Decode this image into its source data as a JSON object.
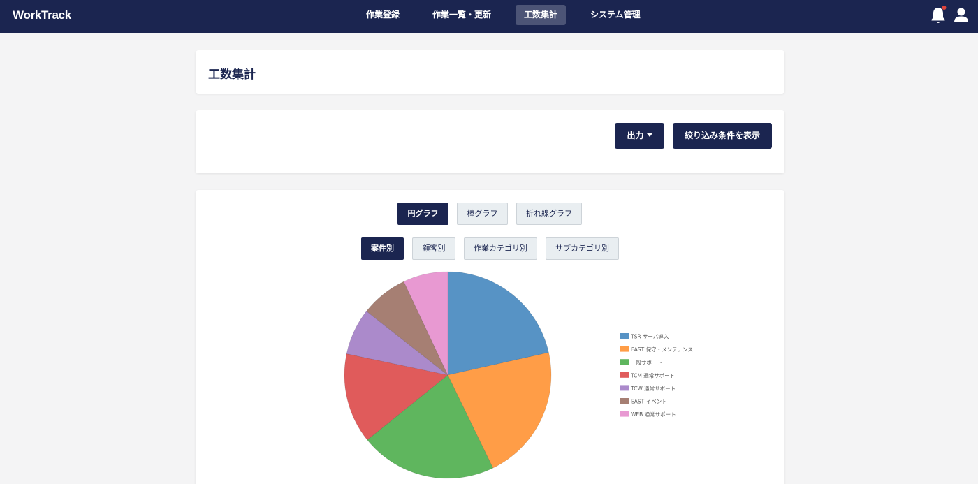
{
  "header": {
    "logo": "WorkTrack",
    "nav": [
      {
        "label": "作業登録",
        "active": false
      },
      {
        "label": "作業一覧・更新",
        "active": false
      },
      {
        "label": "工数集計",
        "active": true
      },
      {
        "label": "システム管理",
        "active": false
      }
    ],
    "notification_badge_color": "#e0443b",
    "icons": [
      "bell-icon",
      "user-icon"
    ]
  },
  "page": {
    "title": "工数集計"
  },
  "toolbar": {
    "export_label": "出力",
    "filter_label": "絞り込み条件を表示"
  },
  "graph_types": [
    {
      "label": "円グラフ",
      "active": true
    },
    {
      "label": "棒グラフ",
      "active": false
    },
    {
      "label": "折れ線グラフ",
      "active": false
    }
  ],
  "groupings": [
    {
      "label": "案件別",
      "active": true
    },
    {
      "label": "顧客別",
      "active": false
    },
    {
      "label": "作業カテゴリ別",
      "active": false
    },
    {
      "label": "サブカテゴリ別",
      "active": false
    }
  ],
  "colors": {
    "primary": "#1b2550",
    "nav_active": "#4c5476",
    "background": "#f4f4f5"
  },
  "chart_data": {
    "type": "pie",
    "categories": [
      "TSR サーバ導入",
      "EAST 保守・メンテナンス",
      "一般サポート",
      "TCM 通常サポート",
      "TCW 通常サポート",
      "EAST イベント",
      "WEB 通常サポート"
    ],
    "values": [
      21.5,
      21.3,
      21.4,
      14.1,
      7.3,
      7.4,
      7.0
    ],
    "colors": [
      "#5793c5",
      "#ff9d47",
      "#5fb65e",
      "#e05b5b",
      "#ab8acb",
      "#a67f73",
      "#e899d2"
    ],
    "legend_position": "right"
  }
}
